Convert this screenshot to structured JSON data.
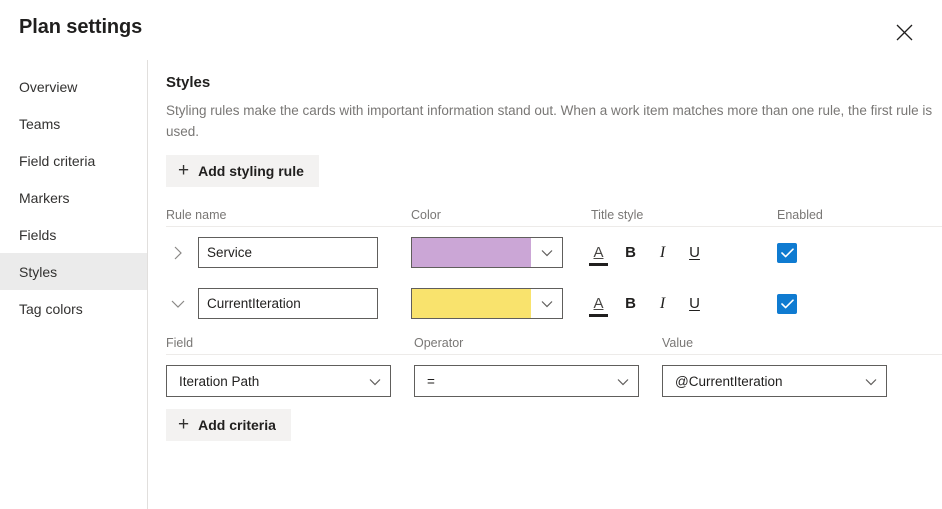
{
  "header": {
    "title": "Plan settings",
    "close_label": "Close"
  },
  "sidebar": {
    "items": [
      {
        "label": "Overview",
        "selected": false
      },
      {
        "label": "Teams",
        "selected": false
      },
      {
        "label": "Field criteria",
        "selected": false
      },
      {
        "label": "Markers",
        "selected": false
      },
      {
        "label": "Fields",
        "selected": false
      },
      {
        "label": "Styles",
        "selected": true
      },
      {
        "label": "Tag colors",
        "selected": false
      }
    ]
  },
  "content": {
    "section_title": "Styles",
    "section_desc": "Styling rules make the cards with important information stand out. When a work item matches more than one rule, the first rule is used.",
    "add_styling_rule_label": "Add styling rule",
    "plus_glyph": "+",
    "table_headers": {
      "rule_name": "Rule name",
      "color": "Color",
      "title_style": "Title style",
      "enabled": "Enabled"
    },
    "rules": [
      {
        "name": "Service",
        "expanded": false,
        "color_hex": "#CBA6D6",
        "title_style": {
          "font_color": "A",
          "bold": "B",
          "italic": "I",
          "underline": "U"
        },
        "enabled": true
      },
      {
        "name": "CurrentIteration",
        "expanded": true,
        "color_hex": "#F9E36D",
        "title_style": {
          "font_color": "A",
          "bold": "B",
          "italic": "I",
          "underline": "U"
        },
        "enabled": true
      }
    ],
    "criteria_headers": {
      "field": "Field",
      "operator": "Operator",
      "value": "Value"
    },
    "criteria_rows": [
      {
        "field": "Iteration Path",
        "operator": "=",
        "value": "@CurrentIteration"
      }
    ],
    "add_criteria_label": "Add criteria"
  },
  "colors": {
    "accent_blue": "#0f7bd1",
    "selected_nav_bg": "#ebebeb",
    "button_bg": "#f3f2f1",
    "border": "#605e5c",
    "divider": "#e1dfdd",
    "muted_text": "#797775"
  }
}
